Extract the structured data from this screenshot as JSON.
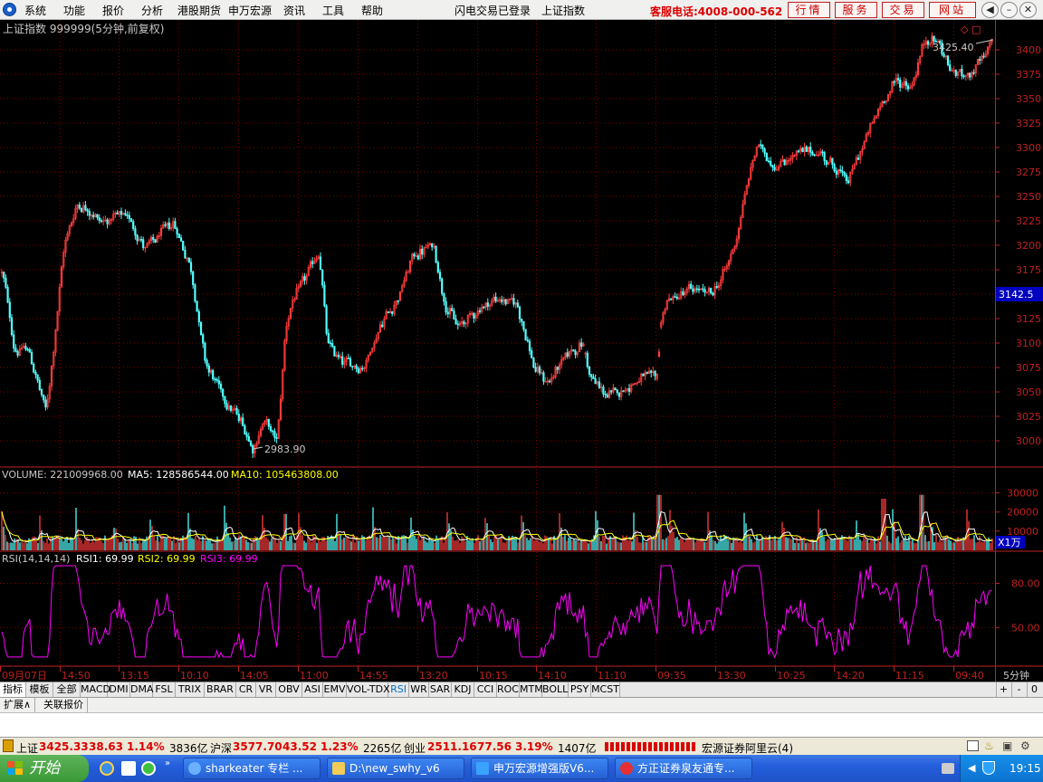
{
  "menu": {
    "items": [
      "系统",
      "功能",
      "报价",
      "分析",
      "港股期货",
      "申万宏源",
      "资讯",
      "工具",
      "帮助"
    ],
    "status1": "闪电交易已登录",
    "status2": "上证指数",
    "hotline": "客服电话:4008-000-562",
    "buttons": [
      "行情",
      "服务",
      "交易",
      "网站"
    ]
  },
  "price_panel": {
    "title": "上证指数 999999(5分钟,前复权)",
    "high_label": "3425.40",
    "low_label": "2983.90",
    "current_price": "3142.5",
    "yticks": [
      "3400",
      "3375",
      "3350",
      "3325",
      "3300",
      "3275",
      "3250",
      "3225",
      "3200",
      "3175",
      "3150",
      "3125",
      "3100",
      "3075",
      "3050",
      "3025",
      "3000"
    ]
  },
  "volume_panel": {
    "label_volume": "VOLUME: 221009968.00",
    "label_ma5": "MA5: 128586544.00",
    "label_ma10": "MA10: 105463808.00",
    "yticks": [
      "30000",
      "20000",
      "10000"
    ],
    "unit": "X1万"
  },
  "rsi_panel": {
    "label_main": "RSI(14,14,14)",
    "label_r1": "RSI1: 69.99",
    "label_r2": "RSI2: 69.99",
    "label_r3": "RSI3: 69.99",
    "yticks": [
      "80.00",
      "50.00"
    ]
  },
  "xaxis": {
    "labels": [
      "09月07日",
      "14:50",
      "13:15",
      "10:10",
      "14:05",
      "11:00",
      "14:55",
      "13:20",
      "10:15",
      "14:10",
      "11:10",
      "09:35",
      "13:30",
      "10:25",
      "14:20",
      "11:15",
      "09:40"
    ],
    "period": "5分钟"
  },
  "tabs": [
    "指标",
    "模板",
    "全部",
    "MACD",
    "DMI",
    "DMA",
    "FSL",
    "TRIX",
    "BRAR",
    "CR",
    "VR",
    "OBV",
    "ASI",
    "EMV",
    "VOL-TDX",
    "RSI",
    "WR",
    "SAR",
    "KDJ",
    "CCI",
    "ROC",
    "MTM",
    "BOLL",
    "PSY",
    "MCST"
  ],
  "subtabs": [
    "扩展∧",
    "关联报价"
  ],
  "statusbar": {
    "sh_name": "上证",
    "sh_price": "3425.33",
    "sh_chg": "38.63",
    "sh_pct": "1.14%",
    "sh_amt": "3836亿",
    "hs_name": "沪深",
    "hs_price": "3577.70",
    "hs_chg": "43.52",
    "hs_pct": "1.23%",
    "hs_amt": "2265亿",
    "cy_name": "创业",
    "cy_price": "2511.16",
    "cy_chg": "77.56",
    "cy_pct": "3.19%",
    "cy_amt": "1407亿",
    "broker": "宏源证券阿里云(4)"
  },
  "taskbar": {
    "start": "开始",
    "tasks": [
      "sharkeater 专栏 ...",
      "D:\\new_swhy_v6",
      "申万宏源增强版V6...",
      "方正证券泉友通专..."
    ],
    "time": "19:15"
  },
  "colors": {
    "up": "#ff3c3c",
    "down": "#54ffff",
    "grid": "#800000",
    "axis": "#c02020",
    "ma5": "#ffffff",
    "ma10": "#ffff00",
    "rsi": "#ff00ff"
  },
  "chart_data": {
    "type": "candlestick",
    "title": "上证指数 999999(5分钟,前复权)",
    "ylim": [
      2975,
      3425
    ],
    "anchor_points": [
      [
        0,
        3185
      ],
      [
        15,
        3090
      ],
      [
        30,
        3095
      ],
      [
        50,
        3025
      ],
      [
        70,
        3205
      ],
      [
        85,
        3245
      ],
      [
        110,
        3225
      ],
      [
        140,
        3230
      ],
      [
        160,
        3195
      ],
      [
        190,
        3225
      ],
      [
        210,
        3175
      ],
      [
        225,
        3080
      ],
      [
        245,
        3045
      ],
      [
        265,
        3020
      ],
      [
        280,
        2990
      ],
      [
        290,
        3025
      ],
      [
        305,
        2995
      ],
      [
        315,
        3130
      ],
      [
        335,
        3165
      ],
      [
        352,
        3195
      ],
      [
        360,
        3095
      ],
      [
        380,
        3080
      ],
      [
        400,
        3075
      ],
      [
        420,
        3120
      ],
      [
        440,
        3150
      ],
      [
        455,
        3190
      ],
      [
        478,
        3200
      ],
      [
        490,
        3140
      ],
      [
        505,
        3115
      ],
      [
        520,
        3130
      ],
      [
        545,
        3145
      ],
      [
        570,
        3140
      ],
      [
        590,
        3070
      ],
      [
        605,
        3060
      ],
      [
        625,
        3090
      ],
      [
        645,
        3100
      ],
      [
        650,
        3065
      ],
      [
        670,
        3045
      ],
      [
        690,
        3055
      ],
      [
        710,
        3065
      ],
      [
        725,
        3062
      ],
      [
        730,
        3140
      ],
      [
        760,
        3155
      ],
      [
        785,
        3150
      ],
      [
        800,
        3175
      ],
      [
        810,
        3200
      ],
      [
        822,
        3255
      ],
      [
        835,
        3305
      ],
      [
        855,
        3280
      ],
      [
        880,
        3295
      ],
      [
        905,
        3295
      ],
      [
        935,
        3265
      ],
      [
        960,
        3320
      ],
      [
        975,
        3350
      ],
      [
        990,
        3370
      ],
      [
        1005,
        3360
      ],
      [
        1020,
        3410
      ],
      [
        1035,
        3410
      ],
      [
        1050,
        3375
      ],
      [
        1070,
        3375
      ],
      [
        1090,
        3395
      ],
      [
        1096,
        3420
      ]
    ],
    "volume_ylim": [
      0,
      35000
    ],
    "rsi_ylim": [
      25,
      100
    ]
  }
}
